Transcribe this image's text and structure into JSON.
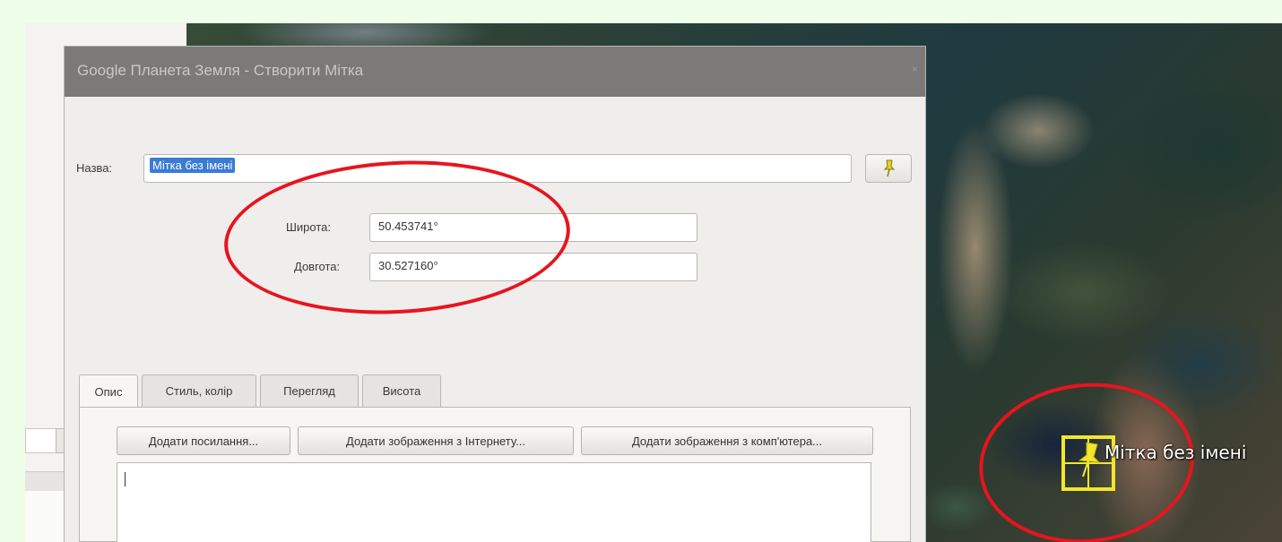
{
  "dialog": {
    "title": "Google Планета Земля - Створити Мітка",
    "close": "×",
    "name_label": "Назва:",
    "name_value": "Мітка без імені",
    "latitude_label": "Широта:",
    "latitude_value": "50.453741°",
    "longitude_label": "Довгота:",
    "longitude_value": "30.527160°",
    "tabs": [
      {
        "label": "Опис",
        "active": true
      },
      {
        "label": "Стиль, колір",
        "active": false
      },
      {
        "label": "Перегляд",
        "active": false
      },
      {
        "label": "Висота",
        "active": false
      }
    ],
    "buttons": {
      "add_link": "Додати посилання...",
      "add_web_image": "Додати зображення з Інтернету...",
      "add_local_image": "Додати зображення з комп'ютера..."
    },
    "description_value": ""
  },
  "map": {
    "placemark_label": "Мітка без імені",
    "placemark_icon": "yellow-pushpin-icon"
  },
  "colors": {
    "annotation": "#e8141e",
    "selection": "#3a7bd5",
    "pin": "#f3e62a"
  }
}
